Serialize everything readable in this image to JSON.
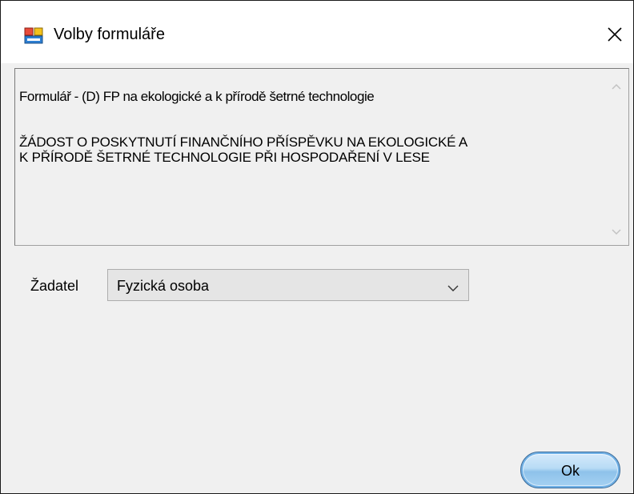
{
  "window": {
    "title": "Volby formuláře",
    "icon": "form-app-icon",
    "close_icon": "close-icon"
  },
  "description": {
    "line1": "Formulář - (D) FP na ekologické a k přírodě šetrné technologie",
    "line2": "ŽÁDOST O POSKYTNUTÍ FINANČNÍHO PŘÍSPĚVKU NA EKOLOGICKÉ A\nK PŘÍRODĚ ŠETRNÉ TECHNOLOGIE PŘI HOSPODAŘENÍ V LESE"
  },
  "applicant": {
    "label": "Žadatel",
    "selected": "Fyzická osoba"
  },
  "ok_label": "Ok",
  "colors": {
    "window_bg": "#f0f0f0",
    "title_bg": "#ffffff",
    "ok_button": "#a7d2f3"
  }
}
